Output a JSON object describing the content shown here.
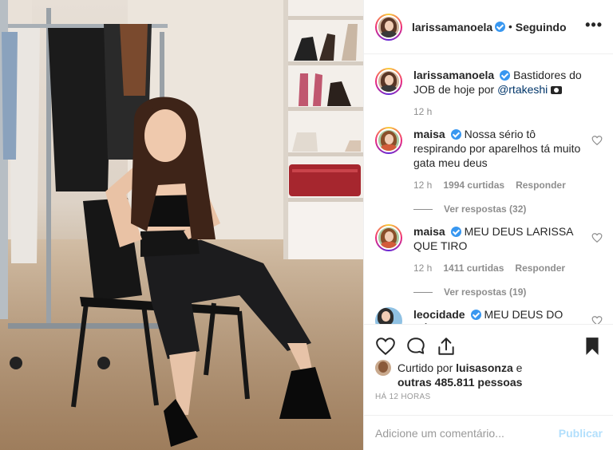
{
  "post": {
    "author": "larissamanoela",
    "separator": "•",
    "follow_status": "Seguindo",
    "more_label": "•••"
  },
  "caption": {
    "username": "larissamanoela",
    "text_before": "Bastidores do JOB de hoje por ",
    "mention": "@rtakeshi",
    "emoji_icon": "camera-icon",
    "time": "12 h"
  },
  "comments": [
    {
      "username": "maisa",
      "text": "Nossa sério tô respirando por aparelhos tá muito gata meu deus",
      "time": "12 h",
      "likes": "1994 curtidas",
      "reply": "Responder",
      "view_replies": "Ver respostas (32)"
    },
    {
      "username": "maisa",
      "text": "MEU DEUS LARISSA QUE TIRO",
      "time": "12 h",
      "likes": "1411 curtidas",
      "reply": "Responder",
      "view_replies": "Ver respostas (19)"
    },
    {
      "username": "leocidade",
      "text": "MEU DEUS DO CÉU"
    }
  ],
  "likes": {
    "prefix": "Curtido por ",
    "user": "luisasonza",
    "and": " e",
    "others": "outras 485.811 pessoas"
  },
  "timestamp": "HÁ 12 HORAS",
  "add_comment": {
    "placeholder": "Adicione um comentário...",
    "publish": "Publicar"
  },
  "colors": {
    "verified": "#3897f0",
    "publish_disabled": "#b2dffc",
    "secondary_text": "#8e8e8e"
  }
}
